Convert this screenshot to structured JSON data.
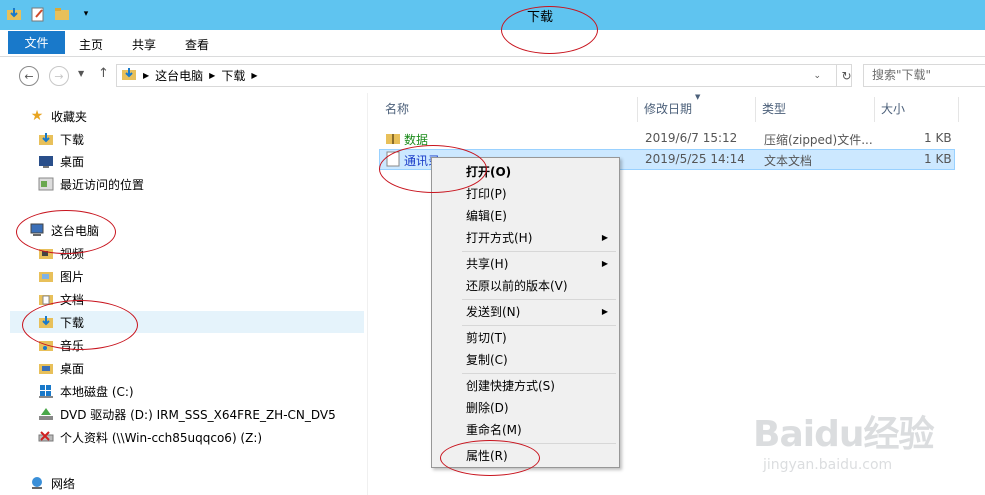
{
  "window": {
    "title": "下载"
  },
  "ribbon": {
    "tabs": [
      "文件",
      "主页",
      "共享",
      "查看"
    ]
  },
  "address": {
    "crumbs": [
      "这台电脑",
      "下载"
    ],
    "search_placeholder": "搜索\"下载\""
  },
  "nav": {
    "favorites_label": "收藏夹",
    "favorites": [
      "下载",
      "桌面",
      "最近访问的位置"
    ],
    "thispc_label": "这台电脑",
    "thispc": [
      "视频",
      "图片",
      "文档",
      "下载",
      "音乐",
      "桌面",
      "本地磁盘 (C:)",
      "DVD 驱动器 (D:) IRM_SSS_X64FRE_ZH-CN_DV5",
      "个人资料 (\\\\Win-cch85uqqco6) (Z:)"
    ],
    "network_label": "网络"
  },
  "columns": [
    "名称",
    "修改日期",
    "类型",
    "大小"
  ],
  "files": [
    {
      "name": "数据",
      "date": "2019/6/7 15:12",
      "type": "压缩(zipped)文件...",
      "size": "1 KB"
    },
    {
      "name": "通讯录",
      "date": "2019/5/25 14:14",
      "type": "文本文档",
      "size": "1 KB"
    }
  ],
  "context_menu": {
    "open": "打开(O)",
    "print": "打印(P)",
    "edit": "编辑(E)",
    "open_with": "打开方式(H)",
    "share": "共享(H)",
    "restore": "还原以前的版本(V)",
    "send_to": "发送到(N)",
    "cut": "剪切(T)",
    "copy": "复制(C)",
    "shortcut": "创建快捷方式(S)",
    "delete": "删除(D)",
    "rename": "重命名(M)",
    "properties": "属性(R)"
  },
  "watermark": {
    "logo": "Baidu经验",
    "url": "jingyan.baidu.com"
  },
  "colors": {
    "titlebar": "#5fc4f0",
    "file_tab": "#1979ca",
    "selection": "#cce8ff",
    "annotation": "#c8141e"
  }
}
